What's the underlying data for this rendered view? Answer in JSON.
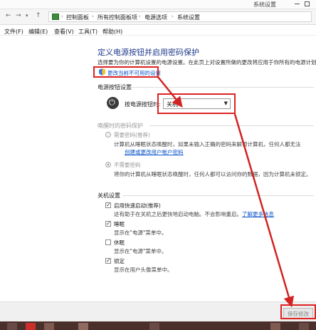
{
  "window": {
    "title": "系统设置"
  },
  "address": {
    "back_arrow": "←",
    "forward_arrow": "→",
    "history_arrow": "▾",
    "up_arrow": "↑",
    "separator": "›",
    "breadcrumbs": [
      "控制面板",
      "所有控制面板项",
      "电源选项",
      "系统设置"
    ]
  },
  "menu": {
    "items": [
      "文件(F)",
      "编辑(E)",
      "查看(V)",
      "工具(T)",
      "帮助(H)"
    ]
  },
  "page": {
    "heading": "定义电源按钮并启用密码保护",
    "intro": "选择要为你的计算机设置的电源设置。在此页上对设置所做的更改将应用于你所有的电源计划。",
    "change_link": "更改当前不可用的设置"
  },
  "power_buttons": {
    "section": "电源按钮设置",
    "label": "按电源按钮时:",
    "selected": "关机"
  },
  "password": {
    "section": "唤醒时的密码保护",
    "require": {
      "label": "需要密码(推荐)",
      "desc1": "计算机从睡眠状态唤醒时，如果未输入正确的密码来解锁计算机，任何人都无法",
      "link": "创建或更改用户帐户密码"
    },
    "norequire": {
      "label": "不需要密码",
      "desc": "将你的计算机从睡眠状态唤醒时，任何人都可以访问你的数据，因为计算机未锁定。"
    }
  },
  "shutdown": {
    "section": "关机设置",
    "fast_startup": {
      "label": "启用快速启动(推荐)",
      "desc": "这有助于在关机之后更快地启动电脑。不会影响重启。",
      "link": "了解更多信息",
      "checked": true
    },
    "sleep": {
      "label": "睡眠",
      "desc": "显示在\"电源\"菜单中。",
      "checked": true
    },
    "hibernate": {
      "label": "休眠",
      "desc": "显示在\"电源\"菜单中。",
      "checked": false
    },
    "lock": {
      "label": "锁定",
      "desc": "显示在用户头像菜单中。",
      "checked": true
    }
  },
  "footer": {
    "save_label": "保存修改"
  },
  "colors": {
    "annotation_red": "#d22222",
    "link_blue": "#0b54c8",
    "heading_blue": "#1e3a8a"
  },
  "icons": [
    "shield-icon",
    "power-icon",
    "chevron-down-icon",
    "control-panel-icon"
  ]
}
